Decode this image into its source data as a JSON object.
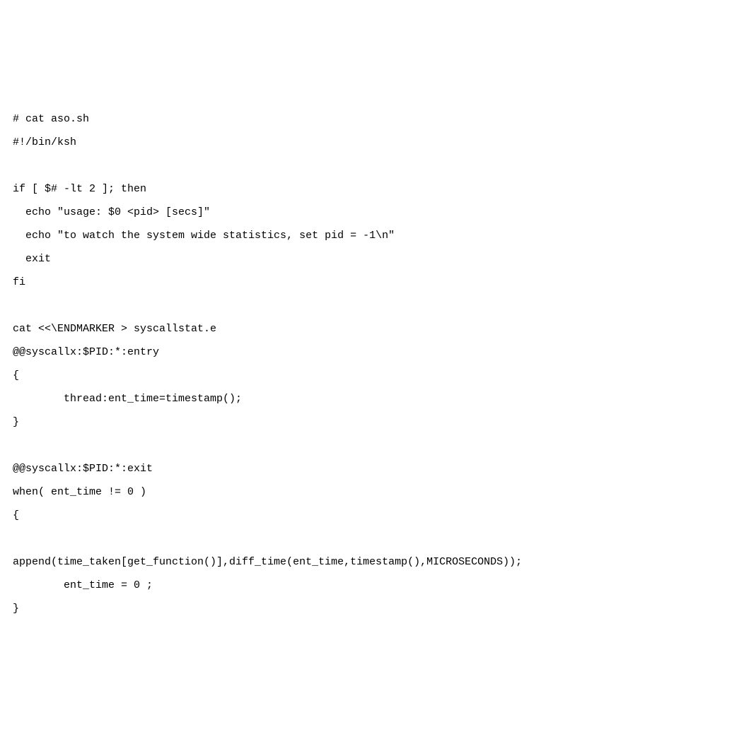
{
  "code": {
    "lines": [
      "# cat aso.sh",
      "#!/bin/ksh",
      "",
      "if [ $# -lt 2 ]; then",
      "  echo \"usage: $0 <pid> [secs]\"",
      "  echo \"to watch the system wide statistics, set pid = -1\\n\"",
      "  exit",
      "fi",
      "",
      "cat <<\\ENDMARKER > syscallstat.e",
      "@@syscallx:$PID:*:entry",
      "{",
      "        thread:ent_time=timestamp();",
      "}",
      "",
      "@@syscallx:$PID:*:exit",
      "when( ent_time != 0 )",
      "{",
      "",
      "append(time_taken[get_function()],diff_time(ent_time,timestamp(),MICROSECONDS));",
      "        ent_time = 0 ;",
      "}"
    ]
  }
}
